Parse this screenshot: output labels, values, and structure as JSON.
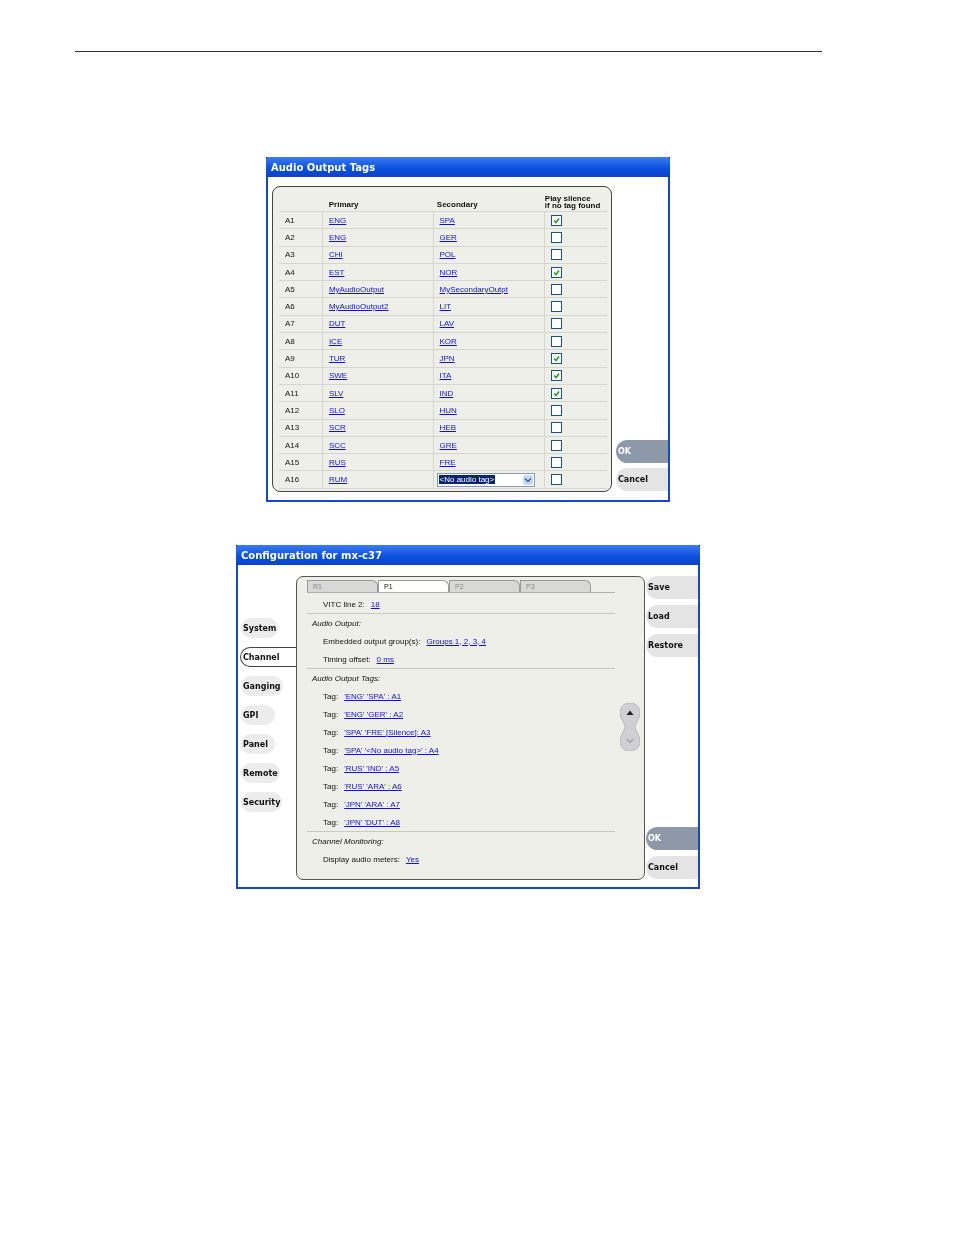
{
  "audio_dialog": {
    "title": "Audio Output Tags",
    "columns": [
      "Primary",
      "Secondary",
      "Play silence\nif no tag found"
    ],
    "rows": [
      {
        "label": "A1",
        "primary": "ENG",
        "secondary": {
          "kind": "link",
          "text": "SPA"
        },
        "checked": true
      },
      {
        "label": "A2",
        "primary": "ENG",
        "secondary": {
          "kind": "link",
          "text": "GER"
        },
        "checked": false
      },
      {
        "label": "A3",
        "primary": "CHI",
        "secondary": {
          "kind": "link",
          "text": "POL"
        },
        "checked": false
      },
      {
        "label": "A4",
        "primary": "EST",
        "secondary": {
          "kind": "link",
          "text": "NOR"
        },
        "checked": true
      },
      {
        "label": "A5",
        "primary": "MyAudioOutput",
        "secondary": {
          "kind": "link",
          "text": "MySecondaryOutpt"
        },
        "checked": false
      },
      {
        "label": "A6",
        "primary": "MyAudioOutput2",
        "secondary": {
          "kind": "link",
          "text": "LIT"
        },
        "checked": false
      },
      {
        "label": "A7",
        "primary": "DUT",
        "secondary": {
          "kind": "link",
          "text": "LAV"
        },
        "checked": false
      },
      {
        "label": "A8",
        "primary": "ICE",
        "secondary": {
          "kind": "link",
          "text": "KOR"
        },
        "checked": false
      },
      {
        "label": "A9",
        "primary": "TUR",
        "secondary": {
          "kind": "link",
          "text": "JPN"
        },
        "checked": true
      },
      {
        "label": "A10",
        "primary": "SWE",
        "secondary": {
          "kind": "link",
          "text": "ITA"
        },
        "checked": true
      },
      {
        "label": "A11",
        "primary": "SLV",
        "secondary": {
          "kind": "link",
          "text": "IND"
        },
        "checked": true
      },
      {
        "label": "A12",
        "primary": "SLO",
        "secondary": {
          "kind": "link",
          "text": "HUN"
        },
        "checked": false
      },
      {
        "label": "A13",
        "primary": "SCR",
        "secondary": {
          "kind": "link",
          "text": "HEB"
        },
        "checked": false
      },
      {
        "label": "A14",
        "primary": "SCC",
        "secondary": {
          "kind": "link",
          "text": "GRE"
        },
        "checked": false
      },
      {
        "label": "A15",
        "primary": "RUS",
        "secondary": {
          "kind": "link",
          "text": "FRE"
        },
        "checked": false
      },
      {
        "label": "A16",
        "primary": "RUM",
        "secondary": {
          "kind": "dropdown",
          "text": "<No audio tag>"
        },
        "checked": false
      }
    ],
    "buttons": [
      {
        "label": "OK",
        "selected": true
      },
      {
        "label": "Cancel",
        "selected": false
      }
    ]
  },
  "config_dialog": {
    "title": "Configuration for mx-c37",
    "nav": [
      {
        "label": "System",
        "selected": false
      },
      {
        "label": "Channel",
        "selected": true
      },
      {
        "label": "Ganging",
        "selected": false
      },
      {
        "label": "GPI",
        "selected": false
      },
      {
        "label": "Panel",
        "selected": false
      },
      {
        "label": "Remote",
        "selected": false
      },
      {
        "label": "Security",
        "selected": false
      }
    ],
    "tabs": [
      {
        "label": "R1",
        "selected": false
      },
      {
        "label": "P1",
        "selected": true
      },
      {
        "label": "P2",
        "selected": false
      },
      {
        "label": "P3",
        "selected": false
      }
    ],
    "sections": [
      {
        "fields": [
          {
            "label": "VITC line 2:",
            "value": "18"
          }
        ]
      },
      {
        "heading": "Audio Output:",
        "fields": [
          {
            "label": "Embedded output group(s):",
            "value": "Groups 1, 2, 3, 4"
          },
          {
            "label": "Timing offset:",
            "value": "0 ms"
          }
        ]
      },
      {
        "heading": "Audio Output Tags:",
        "fields": [
          {
            "label": "Tag:",
            "value": "'ENG' 'SPA' : A1"
          },
          {
            "label": "Tag:",
            "value": "'ENG' 'GER' : A2"
          },
          {
            "label": "Tag:",
            "value": "'SPA' 'FRE' [Silence]: A3"
          },
          {
            "label": "Tag:",
            "value": "'SPA' '<No audio tag>' : A4"
          },
          {
            "label": "Tag:",
            "value": "'RUS' 'IND' : A5"
          },
          {
            "label": "Tag:",
            "value": "'RUS' 'ARA' : A6"
          },
          {
            "label": "Tag:",
            "value": "'JPN' 'ARA' : A7"
          },
          {
            "label": "Tag:",
            "value": "'JPN' 'DUT' : A8"
          }
        ]
      },
      {
        "heading": "Channel Monitoring:",
        "fields": [
          {
            "label": "Display audio meters:",
            "value": "Yes"
          }
        ]
      }
    ],
    "top_buttons": [
      {
        "label": "Save",
        "selected": false
      },
      {
        "label": "Load",
        "selected": false
      },
      {
        "label": "Restore",
        "selected": false
      }
    ],
    "bottom_buttons": [
      {
        "label": "OK",
        "selected": true
      },
      {
        "label": "Cancel",
        "selected": false
      }
    ]
  }
}
